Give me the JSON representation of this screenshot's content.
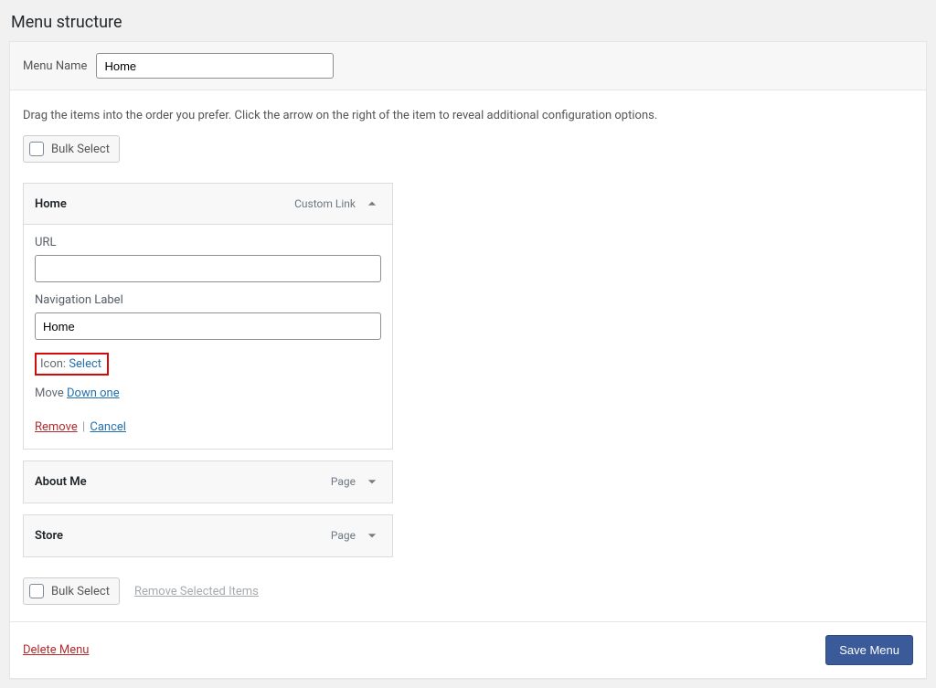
{
  "section_title": "Menu structure",
  "menu_name_label": "Menu Name",
  "menu_name_value": "Home",
  "help_text": "Drag the items into the order you prefer. Click the arrow on the right of the item to reveal additional configuration options.",
  "bulk_select_label": "Bulk Select",
  "remove_selected_label": "Remove Selected Items",
  "items": [
    {
      "title": "Home",
      "type": "Custom Link",
      "expanded": true,
      "url_label": "URL",
      "url_value": "",
      "navlabel_label": "Navigation Label",
      "navlabel_value": "Home",
      "icon_prefix": "Icon: ",
      "icon_select": "Select",
      "move_prefix": "Move ",
      "move_down": "Down one",
      "remove": "Remove",
      "cancel": "Cancel"
    },
    {
      "title": "About Me",
      "type": "Page"
    },
    {
      "title": "Store",
      "type": "Page"
    }
  ],
  "footer": {
    "delete_menu": "Delete Menu",
    "save_menu": "Save Menu"
  }
}
